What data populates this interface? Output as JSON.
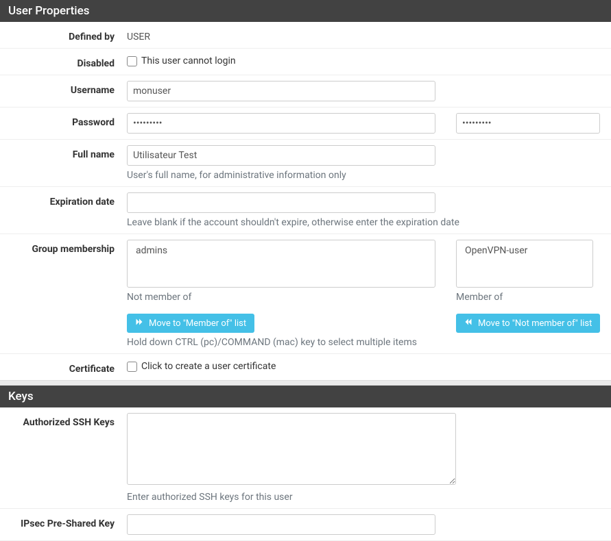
{
  "panels": {
    "userProperties": {
      "title": "User Properties"
    },
    "keys": {
      "title": "Keys"
    }
  },
  "fields": {
    "definedBy": {
      "label": "Defined by",
      "value": "USER"
    },
    "disabled": {
      "label": "Disabled",
      "text": "This user cannot login"
    },
    "username": {
      "label": "Username",
      "value": "monuser"
    },
    "password": {
      "label": "Password",
      "value1": "•••••••••",
      "value2": "•••••••••"
    },
    "fullname": {
      "label": "Full name",
      "value": "Utilisateur Test",
      "help": "User's full name, for administrative information only"
    },
    "expiration": {
      "label": "Expiration date",
      "value": "",
      "help": "Leave blank if the account shouldn't expire, otherwise enter the expiration date"
    },
    "groupMembership": {
      "label": "Group membership",
      "notMemberLabel": "Not member of",
      "memberLabel": "Member of",
      "notMemberOptions": [
        "admins"
      ],
      "memberOptions": [
        "OpenVPN-user"
      ]
    },
    "moveButtons": {
      "toMember": "Move to \"Member of\" list",
      "toNotMember": "Move to \"Not member of\" list",
      "help": "Hold down CTRL (pc)/COMMAND (mac) key to select multiple items"
    },
    "certificate": {
      "label": "Certificate",
      "text": "Click to create a user certificate"
    },
    "sshKeys": {
      "label": "Authorized SSH Keys",
      "value": "",
      "help": "Enter authorized SSH keys for this user"
    },
    "ipsec": {
      "label": "IPsec Pre-Shared Key",
      "value": ""
    }
  }
}
